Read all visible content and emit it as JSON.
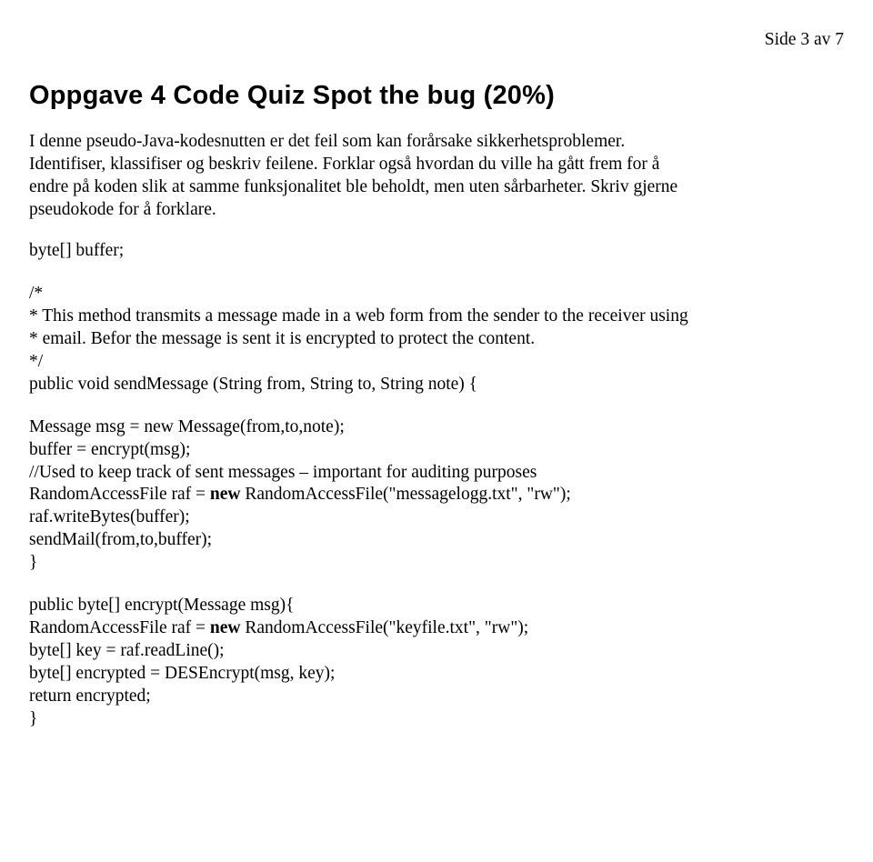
{
  "header": {
    "page_label": "Side 3 av 7"
  },
  "title": "Oppgave 4 Code Quiz Spot the bug (20%)",
  "intro_text": "I denne pseudo-Java-kodesnutten er det feil som kan forårsake sikkerhetsproblemer.\nIdentifiser, klassifiser og beskriv feilene. Forklar også hvordan du ville ha gått frem for å\nendre på koden slik at samme funksjonalitet ble beholdt, men uten sårbarheter. Skriv gjerne\npseudokode for å forklare.",
  "code": {
    "decl": "byte[] buffer;",
    "comment": "/*\n* This method transmits a message made in a web form from the sender to the receiver using\n* email. Befor the message is sent it is encrypted to protect the content.\n*/",
    "sig1": "public void sendMessage (String from, String to, String note) {",
    "body1_a": "Message msg = new Message(from,to,note);\nbuffer = encrypt(msg);\n//Used to keep track of sent messages – important for auditing purposes\nRandomAccessFile raf = ",
    "kw_new1": "new",
    "body1_b": " RandomAccessFile(\"messagelogg.txt\", \"rw\");\nraf.writeBytes(buffer);\nsendMail(from,to,buffer);\n}",
    "sig2": "public byte[] encrypt(Message msg){",
    "body2_a": "RandomAccessFile raf = ",
    "kw_new2": "new",
    "body2_b": " RandomAccessFile(\"keyfile.txt\", \"rw\");\nbyte[] key = raf.readLine();\nbyte[] encrypted = DESEncrypt(msg, key);\nreturn encrypted;\n}"
  }
}
